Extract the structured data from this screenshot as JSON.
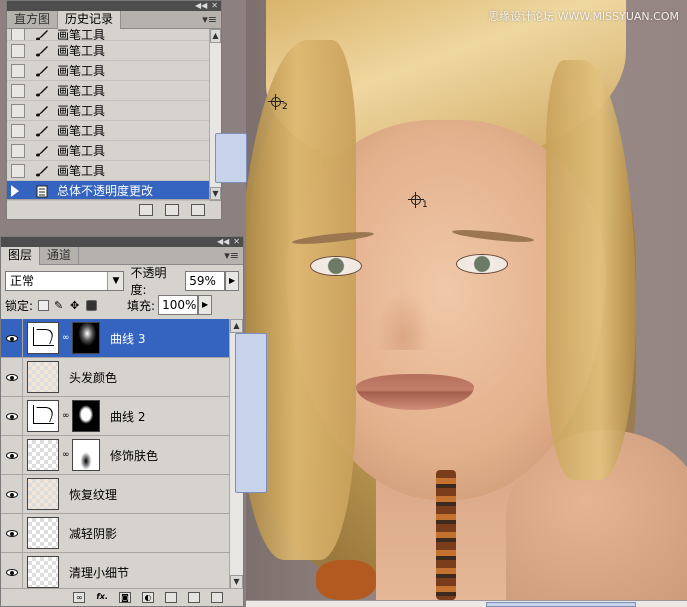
{
  "watermark": "思缘设计论坛 WWW.MISSYUAN.COM",
  "history_panel": {
    "tabs": [
      "直方图",
      "历史记录"
    ],
    "active_tab": 1,
    "menu_icon": "panel-menu-icon",
    "items": [
      {
        "label": "画笔工具",
        "icon": "brush-icon",
        "partial": true
      },
      {
        "label": "画笔工具",
        "icon": "brush-icon"
      },
      {
        "label": "画笔工具",
        "icon": "brush-icon"
      },
      {
        "label": "画笔工具",
        "icon": "brush-icon"
      },
      {
        "label": "画笔工具",
        "icon": "brush-icon"
      },
      {
        "label": "画笔工具",
        "icon": "brush-icon"
      },
      {
        "label": "画笔工具",
        "icon": "brush-icon"
      },
      {
        "label": "画笔工具",
        "icon": "brush-icon"
      },
      {
        "label": "总体不透明度更改",
        "icon": "history-state-icon",
        "selected": true
      }
    ],
    "footer_icons": [
      "new-document-from-state-icon",
      "snapshot-icon",
      "trash-icon"
    ]
  },
  "layers_panel": {
    "tabs": [
      "图层",
      "通道"
    ],
    "active_tab": 0,
    "blend_mode": "正常",
    "opacity_label": "不透明度:",
    "opacity_value": "59%",
    "lock_label": "锁定:",
    "fill_label": "填充:",
    "fill_value": "100%",
    "layers": [
      {
        "name": "曲线 3",
        "thumb": "curve",
        "mask": "dark",
        "selected": true
      },
      {
        "name": "头发颜色",
        "thumb": "paint"
      },
      {
        "name": "曲线 2",
        "thumb": "curve",
        "mask": "blob"
      },
      {
        "name": "修饰肤色",
        "thumb": "transparent",
        "mask": "light"
      },
      {
        "name": "恢复纹理",
        "thumb": "paint"
      },
      {
        "name": "减轻阴影",
        "thumb": "transparent"
      },
      {
        "name": "清理小细节",
        "thumb": "transparent"
      }
    ],
    "footer_icons": [
      "link-layers-icon",
      "fx-icon",
      "add-mask-icon",
      "adjustment-layer-icon",
      "group-icon",
      "new-layer-icon",
      "trash-icon"
    ],
    "fx_label": "fx."
  },
  "canvas": {
    "samplers": [
      {
        "num": "2"
      },
      {
        "num": "1"
      }
    ]
  }
}
